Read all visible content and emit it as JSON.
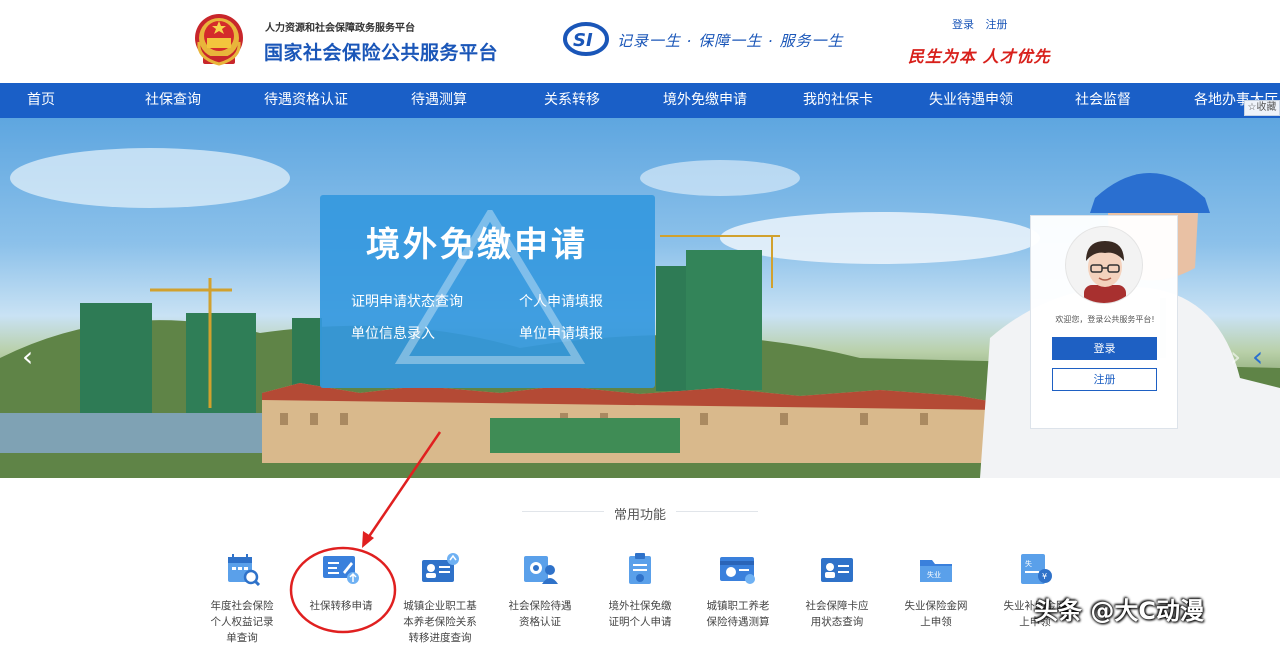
{
  "header": {
    "sub_title": "人力资源和社会保障政务服务平台",
    "title": "国家社会保险公共服务平台",
    "slogan": "记录一生 · 保障一生 · 服务一生",
    "motto": "民生为本 人才优先",
    "login_link": "登录",
    "register_link": "注册"
  },
  "nav": {
    "items": [
      "首页",
      "社保查询",
      "待遇资格认证",
      "待遇测算",
      "关系转移",
      "境外免缴申请",
      "我的社保卡",
      "失业待遇申领",
      "社会监督",
      "各地办事大厅"
    ],
    "favorite": "收藏"
  },
  "banner": {
    "promo_title": "境外免缴申请",
    "links": [
      "证明申请状态查询",
      "个人申请填报",
      "单位信息录入",
      "单位申请填报"
    ]
  },
  "login_card": {
    "welcome": "欢迎您，登录公共服务平台!",
    "login_button": "登录",
    "register_button": "注册"
  },
  "common": {
    "title": "常用功能",
    "items": [
      {
        "lines": [
          "年度社会保险",
          "个人权益记录",
          "单查询"
        ],
        "icon": "calendar-search-icon"
      },
      {
        "lines": [
          "社保转移申请"
        ],
        "icon": "transfer-card-icon"
      },
      {
        "lines": [
          "城镇企业职工基",
          "本养老保险关系",
          "转移进度查询"
        ],
        "icon": "id-card-transfer-icon"
      },
      {
        "lines": [
          "社会保险待遇",
          "资格认证"
        ],
        "icon": "person-badge-icon"
      },
      {
        "lines": [
          "境外社保免缴",
          "证明个人申请"
        ],
        "icon": "clipboard-icon"
      },
      {
        "lines": [
          "城镇职工养老",
          "保险待遇测算"
        ],
        "icon": "calculator-card-icon"
      },
      {
        "lines": [
          "社会保障卡应",
          "用状态查询"
        ],
        "icon": "social-card-icon"
      },
      {
        "lines": [
          "失业保险金网",
          "上申领"
        ],
        "icon": "unemployment-folder-icon"
      },
      {
        "lines": [
          "失业补助金网",
          "上申领"
        ],
        "icon": "subsidy-doc-icon"
      }
    ]
  },
  "watermark": "头条 @大C动漫",
  "colors": {
    "nav": "#1a5fc7",
    "brand_blue": "#1a56b8",
    "motto_red": "#d8201b",
    "annotation_red": "#e02020"
  }
}
